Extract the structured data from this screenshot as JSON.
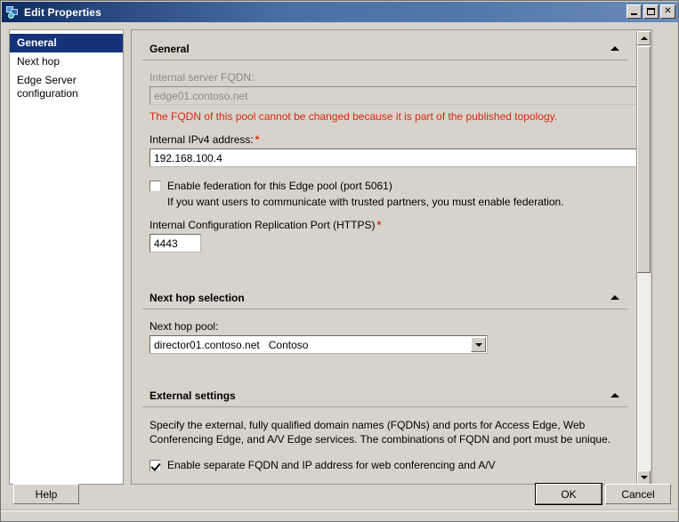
{
  "window": {
    "title": "Edit Properties",
    "icon": "properties-icon",
    "controls": {
      "minimize": "minimize-button",
      "maximize": "maximize-button",
      "close_label": "✕"
    }
  },
  "sidebar": {
    "items": [
      {
        "label": "General",
        "selected": true
      },
      {
        "label": "Next hop",
        "selected": false
      },
      {
        "label": "Edge Server configuration",
        "selected": false
      }
    ]
  },
  "sections": {
    "general": {
      "heading": "General",
      "fqdn_label": "Internal server FQDN:",
      "fqdn_value": "edge01.contoso.net",
      "fqdn_error": "The FQDN of this pool cannot be changed because it is part of the published topology.",
      "ipv4_label": "Internal IPv4 address:",
      "ipv4_required": "*",
      "ipv4_value": "192.168.100.4",
      "federation_checkbox_label": "Enable federation for this Edge pool (port 5061)",
      "federation_checked": false,
      "federation_hint": "If you want users to communicate with trusted partners, you must enable federation.",
      "repl_port_label": "Internal Configuration Replication Port (HTTPS)",
      "repl_port_required": "*",
      "repl_port_value": "4443"
    },
    "next_hop": {
      "heading": "Next hop selection",
      "pool_label": "Next hop pool:",
      "pool_value": "director01.contoso.net   Contoso"
    },
    "external": {
      "heading": "External settings",
      "description": "Specify the external, fully qualified domain names (FQDNs) and ports for Access Edge, Web Conferencing Edge, and A/V Edge services. The combinations of FQDN and port must be unique.",
      "separate_fqdn_label": "Enable separate FQDN and IP address for web conferencing and A/V",
      "separate_fqdn_checked": true
    }
  },
  "footer": {
    "help_label": "Help",
    "ok_label": "OK",
    "cancel_label": "Cancel"
  },
  "colors": {
    "dialog_bg": "#d7d3cb",
    "title_blue": "#4a6fa5",
    "selection_blue": "#16327a",
    "error_red": "#d42a12",
    "required_red": "#d42a12"
  }
}
